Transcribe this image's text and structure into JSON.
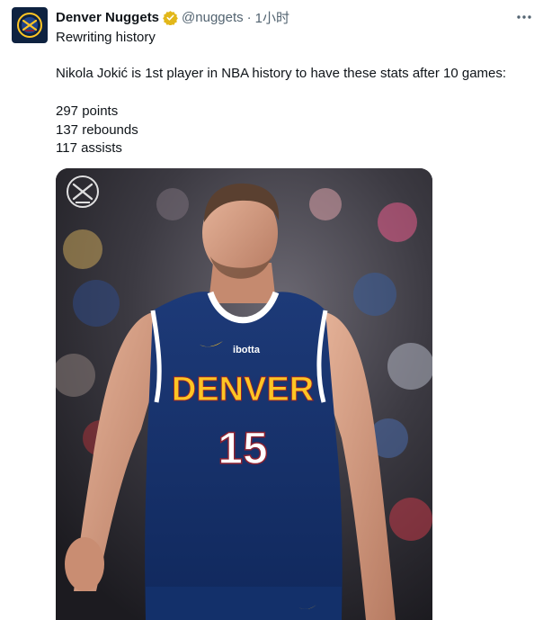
{
  "tweet": {
    "author_name": "Denver Nuggets",
    "handle": "@nuggets",
    "separator": "·",
    "time": "1小时",
    "more_icon": "more-horizontal-icon",
    "verified_icon": "verified-gold-badge-icon",
    "subline": "Rewriting history",
    "headline": "Nikola Jokić is 1st player in NBA history to have these stats after 10 games:",
    "stats": [
      "297 points",
      "137 rebounds",
      "117 assists"
    ]
  },
  "photo": {
    "jersey_team": "DENVER",
    "jersey_number": "15",
    "sponsor": "ibotta"
  },
  "colors": {
    "nuggets_navy": "#0e2240",
    "nuggets_gold": "#fec524",
    "verified_gold": "#e2b719",
    "handle_gray": "#536471"
  }
}
